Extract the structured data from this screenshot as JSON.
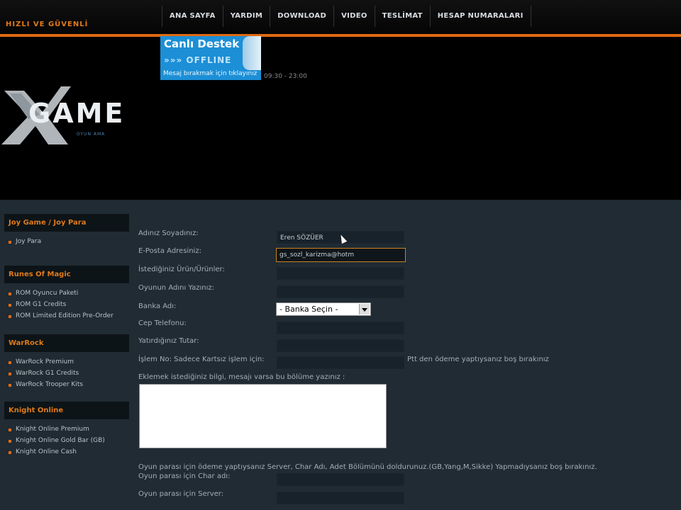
{
  "header": {
    "tagline": "HIZLI VE GÜVENLİ",
    "nav": [
      "ANA SAYFA",
      "YARDIM",
      "DOWNLOAD",
      "VIDEO",
      "TESLİMAT",
      "HESAP NUMARALARI"
    ],
    "support": {
      "title": "Canlı Destek",
      "status": "»»» OFFLINE",
      "message": "Mesaj bırakmak için tıklayınız"
    },
    "hours": "09:30 - 23:00",
    "logo": {
      "word": "GAME",
      "sub": "OYUN AMA"
    }
  },
  "sidebar": {
    "categories": [
      {
        "title": "Joy Game / Joy Para",
        "items": [
          "Joy Para"
        ]
      },
      {
        "title": "Runes Of Magic",
        "items": [
          "ROM Oyuncu Paketi",
          "ROM G1 Credits",
          "ROM Limited Edition Pre-Order"
        ]
      },
      {
        "title": "WarRock",
        "items": [
          "WarRock Premium",
          "WarRock G1 Credits",
          "WarRock Trooper Kits"
        ]
      },
      {
        "title": "Knight Online",
        "items": [
          "Knight Online Premium",
          "Knight Online Gold Bar (GB)",
          "Knight Online Cash"
        ]
      }
    ]
  },
  "form": {
    "name_label": "Adınız Soyadınız:",
    "name_value": "Eren SÖZÜER",
    "email_label": "E-Posta Adresiniz:",
    "email_value": "gs_sozl_karizma@hotm",
    "product_label": "İstediğiniz Ürün/Ürünler:",
    "game_label": "Oyunun Adını Yazınız:",
    "bank_label": "Banka Adı:",
    "bank_select": "- Banka Seçin -",
    "phone_label": "Cep Telefonu:",
    "amount_label": "Yatırdığınız Tutar:",
    "txn_label": "İşlem No: Sadece Kartsız işlem için:",
    "txn_note": "Ptt den ödeme yaptıysanız boş bırakınız",
    "message_label": "Eklemek istediğiniz bilgi, mesajı varsa bu bölüme yazınız :",
    "game_money_note": "Oyun parası için ödeme yaptıysanız Server, Char Adı, Adet Bölümünü doldurunuz.(GB,Yang,M,Sikke) Yapmadıysanız boş bırakınız.",
    "char_label": "Oyun parası için Char adı:",
    "server_label": "Oyun parası için Server:"
  }
}
